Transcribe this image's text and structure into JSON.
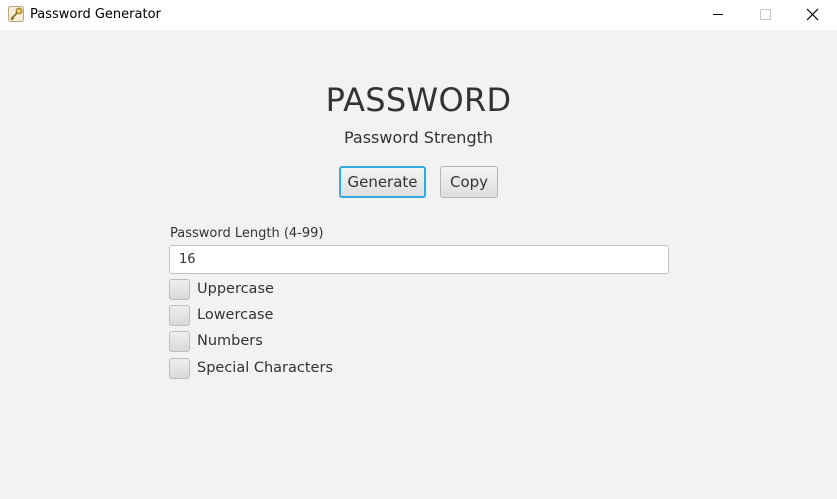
{
  "window": {
    "title": "Password Generator",
    "icon": "key-icon",
    "controls": [
      "minimize-icon",
      "maximize-icon",
      "close-icon"
    ]
  },
  "main": {
    "password_display": "PASSWORD",
    "strength_label": "Password Strength",
    "buttons": {
      "generate": "Generate",
      "copy": "Copy"
    },
    "length": {
      "label": "Password Length (4-99)",
      "value": "16"
    },
    "options": [
      {
        "label": "Uppercase",
        "checked": false
      },
      {
        "label": "Lowercase",
        "checked": false
      },
      {
        "label": "Numbers",
        "checked": false
      },
      {
        "label": "Special Characters",
        "checked": false
      }
    ]
  },
  "colors": {
    "background": "#f2f2f2",
    "focus_accent": "#35a9dc",
    "text": "#333333"
  }
}
